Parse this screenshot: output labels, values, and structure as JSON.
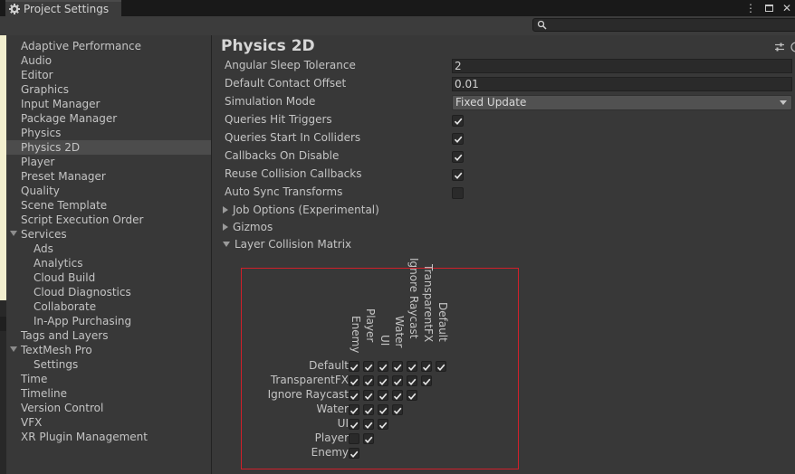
{
  "window": {
    "tab_title": "Project Settings",
    "search_placeholder": ""
  },
  "sidebar": {
    "items": [
      {
        "label": "Adaptive Performance",
        "level": 0
      },
      {
        "label": "Audio",
        "level": 0
      },
      {
        "label": "Editor",
        "level": 0
      },
      {
        "label": "Graphics",
        "level": 0
      },
      {
        "label": "Input Manager",
        "level": 0
      },
      {
        "label": "Package Manager",
        "level": 0
      },
      {
        "label": "Physics",
        "level": 0
      },
      {
        "label": "Physics 2D",
        "level": 0,
        "selected": true
      },
      {
        "label": "Player",
        "level": 0
      },
      {
        "label": "Preset Manager",
        "level": 0
      },
      {
        "label": "Quality",
        "level": 0
      },
      {
        "label": "Scene Template",
        "level": 0
      },
      {
        "label": "Script Execution Order",
        "level": 0
      },
      {
        "label": "Services",
        "level": 0,
        "expanded": true
      },
      {
        "label": "Ads",
        "level": 1
      },
      {
        "label": "Analytics",
        "level": 1
      },
      {
        "label": "Cloud Build",
        "level": 1
      },
      {
        "label": "Cloud Diagnostics",
        "level": 1
      },
      {
        "label": "Collaborate",
        "level": 1
      },
      {
        "label": "In-App Purchasing",
        "level": 1
      },
      {
        "label": "Tags and Layers",
        "level": 0
      },
      {
        "label": "TextMesh Pro",
        "level": 0,
        "expanded": true
      },
      {
        "label": "Settings",
        "level": 1
      },
      {
        "label": "Time",
        "level": 0
      },
      {
        "label": "Timeline",
        "level": 0
      },
      {
        "label": "Version Control",
        "level": 0
      },
      {
        "label": "VFX",
        "level": 0
      },
      {
        "label": "XR Plugin Management",
        "level": 0
      }
    ]
  },
  "main": {
    "title": "Physics 2D",
    "properties": [
      {
        "label": "Angular Sleep Tolerance",
        "type": "field",
        "value": "2"
      },
      {
        "label": "Default Contact Offset",
        "type": "field",
        "value": "0.01"
      },
      {
        "label": "Simulation Mode",
        "type": "dropdown",
        "value": "Fixed Update"
      },
      {
        "label": "Queries Hit Triggers",
        "type": "checkbox",
        "checked": true
      },
      {
        "label": "Queries Start In Colliders",
        "type": "checkbox",
        "checked": true
      },
      {
        "label": "Callbacks On Disable",
        "type": "checkbox",
        "checked": true
      },
      {
        "label": "Reuse Collision Callbacks",
        "type": "checkbox",
        "checked": true
      },
      {
        "label": "Auto Sync Transforms",
        "type": "checkbox",
        "checked": false
      }
    ],
    "foldouts": [
      {
        "label": "Job Options (Experimental)",
        "expanded": false
      },
      {
        "label": "Gizmos",
        "expanded": false
      },
      {
        "label": "Layer Collision Matrix",
        "expanded": true
      }
    ],
    "matrix": {
      "layers": [
        "Default",
        "TransparentFX",
        "Ignore Raycast",
        "Water",
        "UI",
        "Player",
        "Enemy"
      ],
      "rows": [
        [
          true,
          true,
          true,
          true,
          true,
          true,
          true
        ],
        [
          true,
          true,
          true,
          true,
          true,
          true
        ],
        [
          true,
          true,
          true,
          true,
          true
        ],
        [
          true,
          true,
          true,
          true
        ],
        [
          true,
          true,
          true
        ],
        [
          false,
          true
        ],
        [
          true
        ]
      ]
    }
  },
  "colors": {
    "highlight_border": "#d0202a",
    "selected_item": "#4c4c4c"
  }
}
